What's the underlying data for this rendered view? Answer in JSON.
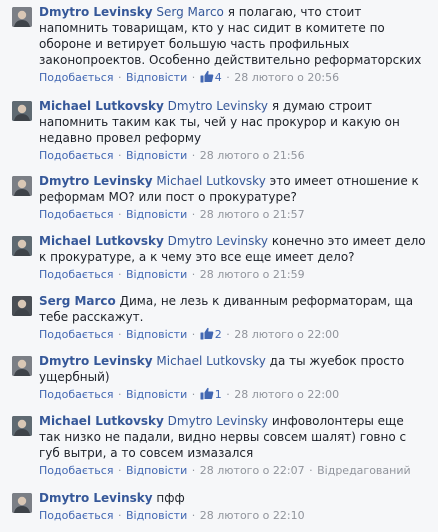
{
  "ui": {
    "like": "Подобається",
    "reply": "Відповісти",
    "edited": "Відредагований",
    "dot": " · "
  },
  "comments": [
    {
      "author": "Dmytro Levinsky",
      "mention": "Serg Marco",
      "text": "я полагаю, что стоит напомнить товарищам, кто у нас сидит в комитете по обороне и ветирует большую часть профильных законопроектов. Особенно действительно реформаторских",
      "likes": "4",
      "time": "28 лютого о 20:56",
      "avatar_color": "#7b7f86"
    },
    {
      "author": "Michael Lutkovsky",
      "mention": "Dmytro Levinsky",
      "text": "я думаю строит напомнить таким как ты, чей у нас прокурор и какую он недавно провел реформу",
      "time": "28 лютого о 21:56",
      "avatar_color": "#5f6a72"
    },
    {
      "author": "Dmytro Levinsky",
      "mention": "Michael Lutkovsky",
      "text": "это имеет отношение к реформам МО? или пост о прокуратуре?",
      "time": "28 лютого о 21:57",
      "avatar_color": "#7b7f86"
    },
    {
      "author": "Michael Lutkovsky",
      "mention": "Dmytro Levinsky",
      "text": "конечно это имеет дело к прокуратуре, а к чему это все еще имеет дело?",
      "time": "28 лютого о 21:59",
      "avatar_color": "#5f6a72"
    },
    {
      "author": "Serg Marco",
      "mention": "",
      "text": "Дима, не лезь к диванным реформаторам, ща тебе расскажут.",
      "likes": "2",
      "time": "28 лютого о 22:00",
      "avatar_color": "#4a4f55"
    },
    {
      "author": "Dmytro Levinsky",
      "mention": "Michael Lutkovsky",
      "text": "да ты жуебок просто ущербный)",
      "likes": "1",
      "time": "28 лютого о 22:00",
      "avatar_color": "#7b7f86"
    },
    {
      "author": "Michael Lutkovsky",
      "mention": "Dmytro Levinsky",
      "text": "инфоволонтеры еще так низко не падали, видно нервы совсем шалят) говно с губ вытри, а то совсем измазался",
      "time": "28 лютого о 22:07",
      "edited": true,
      "avatar_color": "#5f6a72"
    },
    {
      "author": "Dmytro Levinsky",
      "mention": "",
      "text": "пфф",
      "time": "28 лютого о 22:10",
      "avatar_color": "#7b7f86"
    }
  ]
}
